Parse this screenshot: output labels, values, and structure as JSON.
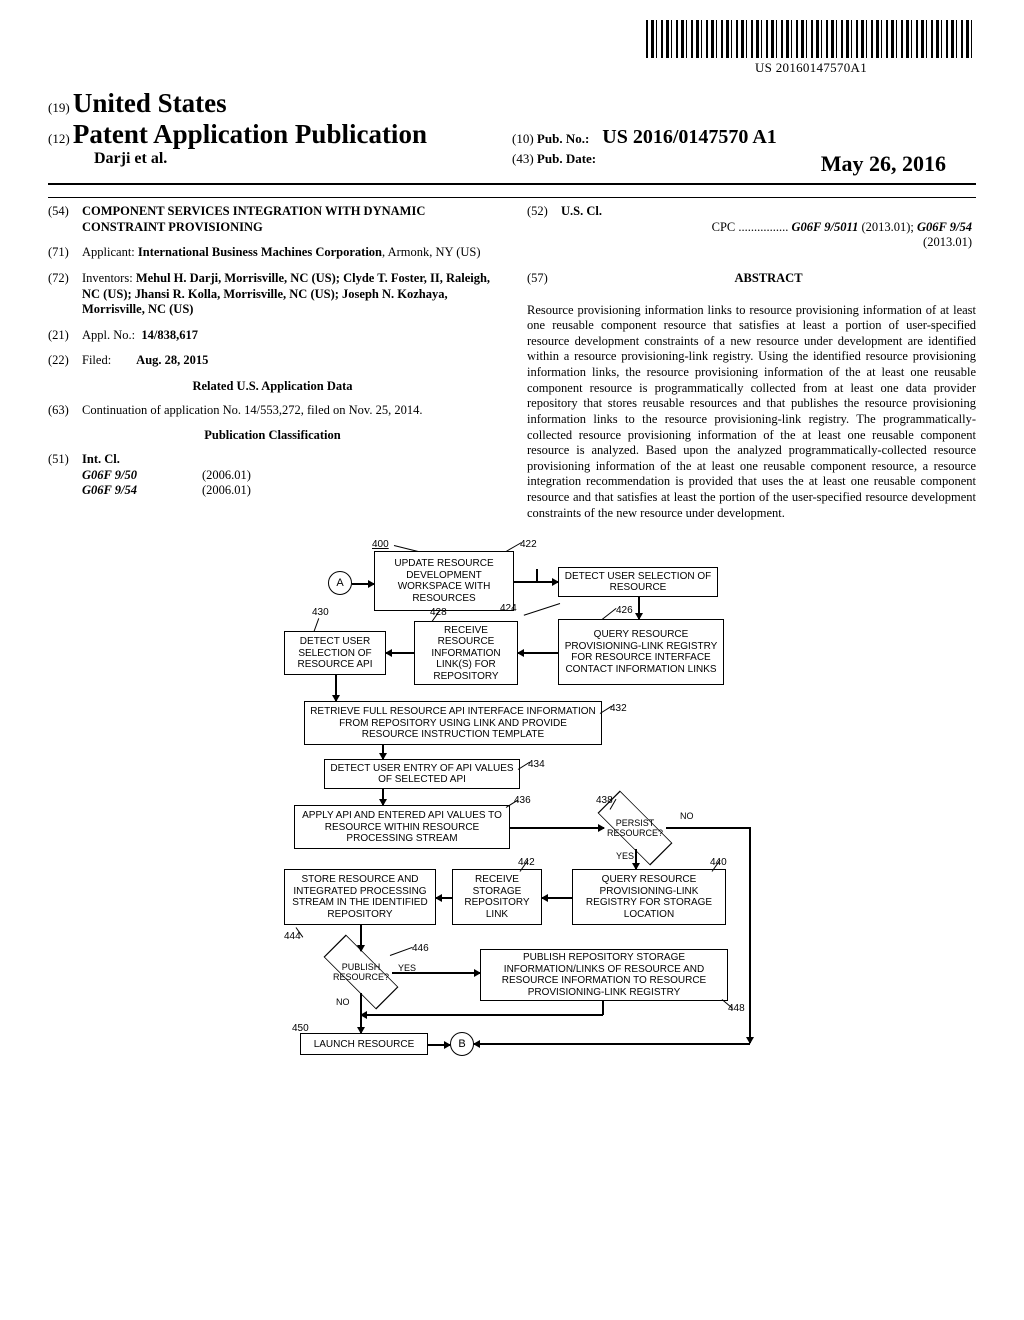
{
  "barcode_text": "US 20160147570A1",
  "header": {
    "code19": "(19)",
    "country": "United States",
    "code12": "(12)",
    "pub_type": "Patent Application Publication",
    "authors_line": "Darji et al.",
    "code10": "(10)",
    "pubno_label": "Pub. No.:",
    "pubno_value": "US 2016/0147570 A1",
    "code43": "(43)",
    "pubdate_label": "Pub. Date:",
    "pubdate_value": "May 26, 2016"
  },
  "s54": {
    "num": "(54)",
    "title": "COMPONENT SERVICES INTEGRATION WITH DYNAMIC CONSTRAINT PROVISIONING"
  },
  "s71": {
    "num": "(71)",
    "label": "Applicant:",
    "value_bold": "International Business Machines Corporation",
    "value_tail": ", Armonk, NY (US)"
  },
  "s72": {
    "num": "(72)",
    "label": "Inventors:",
    "value": "Mehul H. Darji, Morrisville, NC (US); Clyde T. Foster, II, Raleigh, NC (US); Jhansi R. Kolla, Morrisville, NC (US); Joseph N. Kozhaya, Morrisville, NC (US)"
  },
  "s21": {
    "num": "(21)",
    "label": "Appl. No.:",
    "value": "14/838,617"
  },
  "s22": {
    "num": "(22)",
    "label": "Filed:",
    "value": "Aug. 28, 2015"
  },
  "related_title": "Related U.S. Application Data",
  "s63": {
    "num": "(63)",
    "value": "Continuation of application No. 14/553,272, filed on Nov. 25, 2014."
  },
  "pubclass_title": "Publication Classification",
  "s51": {
    "num": "(51)",
    "label": "Int. Cl.",
    "rows": [
      {
        "code": "G06F 9/50",
        "date": "(2006.01)"
      },
      {
        "code": "G06F 9/54",
        "date": "(2006.01)"
      }
    ]
  },
  "s52": {
    "num": "(52)",
    "label": "U.S. Cl.",
    "cpc_label": "CPC",
    "dots": " ................ ",
    "val1": "G06F 9/5011",
    "d1": " (2013.01); ",
    "val2": "G06F 9/54",
    "d2": " (2013.01)"
  },
  "abstract": {
    "num": "(57)",
    "title": "ABSTRACT",
    "body": "Resource provisioning information links to resource provisioning information of at least one reusable component resource that satisfies at least a portion of user-specified resource development constraints of a new resource under development are identified within a resource provisioning-link registry. Using the identified resource provisioning information links, the resource provisioning information of the at least one reusable component resource is programmatically collected from at least one data provider repository that stores reusable resources and that publishes the resource provisioning information links to the resource provisioning-link registry. The programmatically-collected resource provisioning information of the at least one reusable component resource is analyzed. Based upon the analyzed programmatically-collected resource provisioning information of the at least one reusable component resource, a resource integration recommendation is provided that uses the at least one reusable component resource and that satisfies at least the portion of the user-specified resource development constraints of the new resource under development."
  },
  "figure": {
    "ref400": "400",
    "nA": "A",
    "b1": "UPDATE RESOURCE DEVELOPMENT WORKSPACE WITH RESOURCES",
    "l422": "422",
    "b2": "DETECT USER SELECTION OF RESOURCE",
    "l424": "424",
    "b3": "QUERY RESOURCE PROVISIONING-LINK REGISTRY FOR RESOURCE INTERFACE CONTACT INFORMATION LINKS",
    "l426": "426",
    "b4": "RECEIVE RESOURCE INFORMATION LINK(S) FOR REPOSITORY",
    "l428": "428",
    "b5": "DETECT USER SELECTION OF RESOURCE API",
    "l430": "430",
    "b6": "RETRIEVE FULL RESOURCE API INTERFACE INFORMATION FROM REPOSITORY USING LINK AND PROVIDE RESOURCE INSTRUCTION TEMPLATE",
    "l432": "432",
    "b7": "DETECT USER ENTRY OF API VALUES OF SELECTED API",
    "l434": "434",
    "b8": "APPLY API AND ENTERED API VALUES TO RESOURCE WITHIN RESOURCE PROCESSING STREAM",
    "l436": "436",
    "d1": "PERSIST RESOURCE?",
    "l438": "438",
    "yes1": "YES",
    "no1": "NO",
    "b9": "QUERY RESOURCE PROVISIONING-LINK REGISTRY FOR STORAGE LOCATION",
    "l440": "440",
    "b10": "RECEIVE STORAGE REPOSITORY LINK",
    "l442": "442",
    "b11": "STORE RESOURCE AND INTEGRATED PROCESSING STREAM IN THE IDENTIFIED REPOSITORY",
    "l444": "444",
    "d2": "PUBLISH RESOURCE?",
    "l446": "446",
    "yes2": "YES",
    "no2": "NO",
    "b12": "PUBLISH REPOSITORY STORAGE INFORMATION/LINKS OF RESOURCE AND RESOURCE INFORMATION TO RESOURCE PROVISIONING-LINK REGISTRY",
    "l448": "448",
    "b13": "LAUNCH RESOURCE",
    "l450": "450",
    "nB": "B"
  }
}
